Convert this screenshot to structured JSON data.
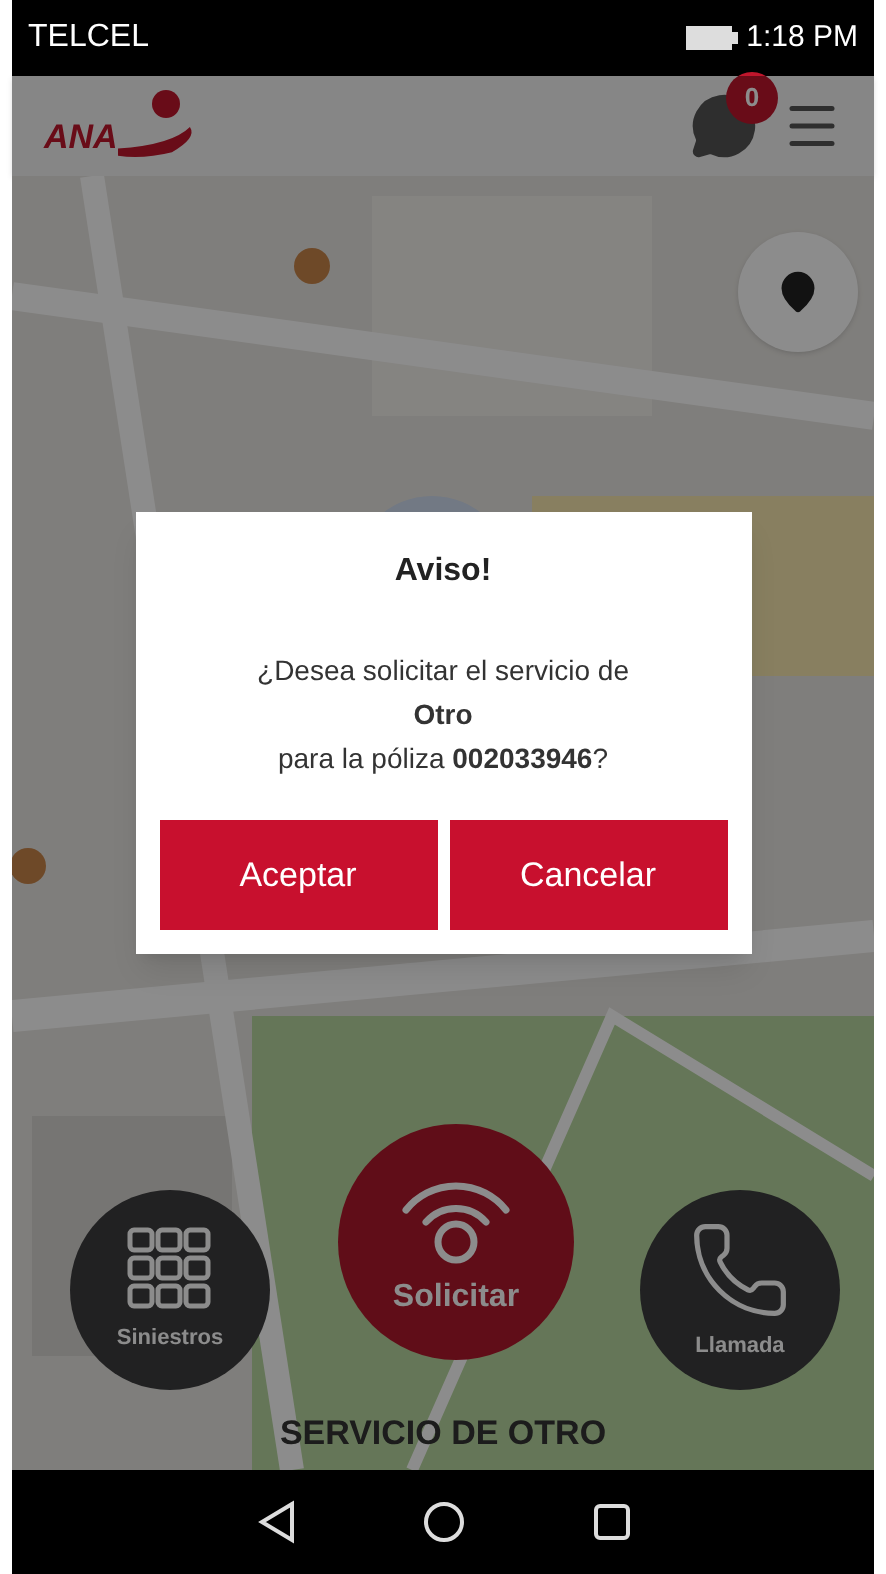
{
  "status_bar": {
    "carrier": "TELCEL",
    "time": "1:18 PM"
  },
  "header": {
    "logo": "ANA",
    "messages_badge": "0"
  },
  "dialog": {
    "title": "Aviso!",
    "message": "¿Desea solicitar el servicio de\n**Otro**\npara la póliza **002033946**?",
    "buttons": [
      "Aceptar",
      "Cancelar"
    ]
  },
  "actions": [
    {
      "kind": "grid",
      "label": "Siniestros"
    },
    {
      "kind": "signal",
      "label": "Solicitar"
    },
    {
      "kind": "phone",
      "label": "Llamada"
    }
  ],
  "footer_label": "SERVICIO DE OTRO"
}
